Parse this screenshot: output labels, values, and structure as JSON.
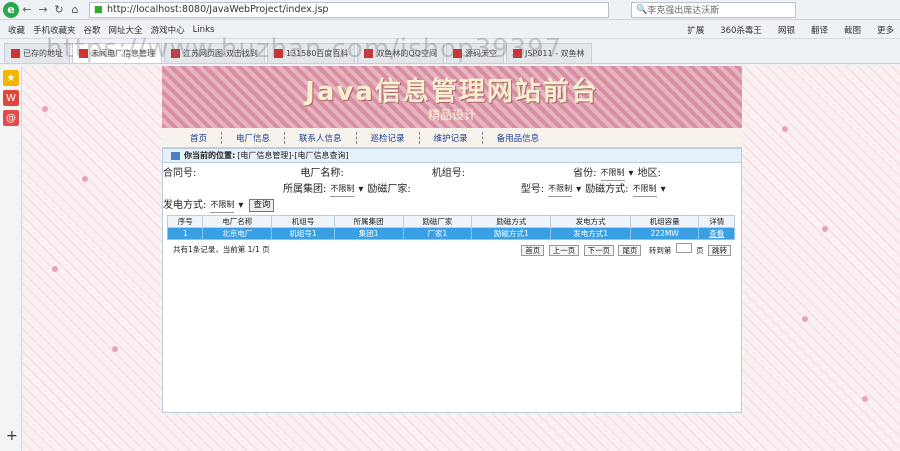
{
  "browser": {
    "url": "http://localhost:8080/JavaWebProject/index.jsp",
    "search_placeholder": "李克强出席达沃斯",
    "bookmarks": [
      "收藏",
      "手机收藏夹",
      "谷歌",
      "网址大全",
      "游戏中心",
      "Links"
    ],
    "bookmarks_right": [
      "扩展",
      "360杀毒王",
      "网银",
      "翻译",
      "截图",
      "更多"
    ],
    "tabs": [
      "已存的地址",
      "未闻电厂信息管理",
      "江苏网页图-双击找到",
      "131580百度百科",
      "双鱼林的QQ空间",
      "源码天空",
      "JSP011 - 双鱼林"
    ]
  },
  "watermark": "https://www.huzhan.com/ishop39397",
  "banner": {
    "title": "Java信息管理网站前台",
    "subtitle": "精品设计"
  },
  "nav": [
    "首页",
    "电厂信息",
    "联系人信息",
    "巡检记录",
    "维护记录",
    "备用品信息"
  ],
  "crumb": {
    "label": "你当前的位置:",
    "path": "[电厂信息管理]-[电厂信息查询]"
  },
  "filters": {
    "contract_no": "合同号:",
    "plant_name": "电厂名称:",
    "unit_no": "机组号:",
    "province": "省份:",
    "province_val": "不限制",
    "region": "地区:",
    "group": "所属集团:",
    "group_val": "不限制",
    "boiler_maker": "励磁厂家:",
    "model": "型号:",
    "model_val": "不限制",
    "excitation": "励磁方式:",
    "excitation_val": "不限制",
    "gen_method": "发电方式:",
    "gen_val": "不限制",
    "query": "查询"
  },
  "table": {
    "headers": [
      "序号",
      "电厂名称",
      "机组号",
      "所属集团",
      "励磁厂家",
      "励磁方式",
      "发电方式",
      "机组容量",
      "详情"
    ],
    "rows": [
      [
        "1",
        "北京电厂",
        "机组号1",
        "集团1",
        "厂家1",
        "励磁方式1",
        "发电方式1",
        "222MW",
        "查看"
      ]
    ]
  },
  "pager": {
    "summary": "共有1条记录，当前第 1/1 页",
    "first": "首页",
    "prev": "上一页",
    "next": "下一页",
    "last": "尾页",
    "goto": "转到第",
    "page_unit": "页",
    "go": "跳转"
  }
}
